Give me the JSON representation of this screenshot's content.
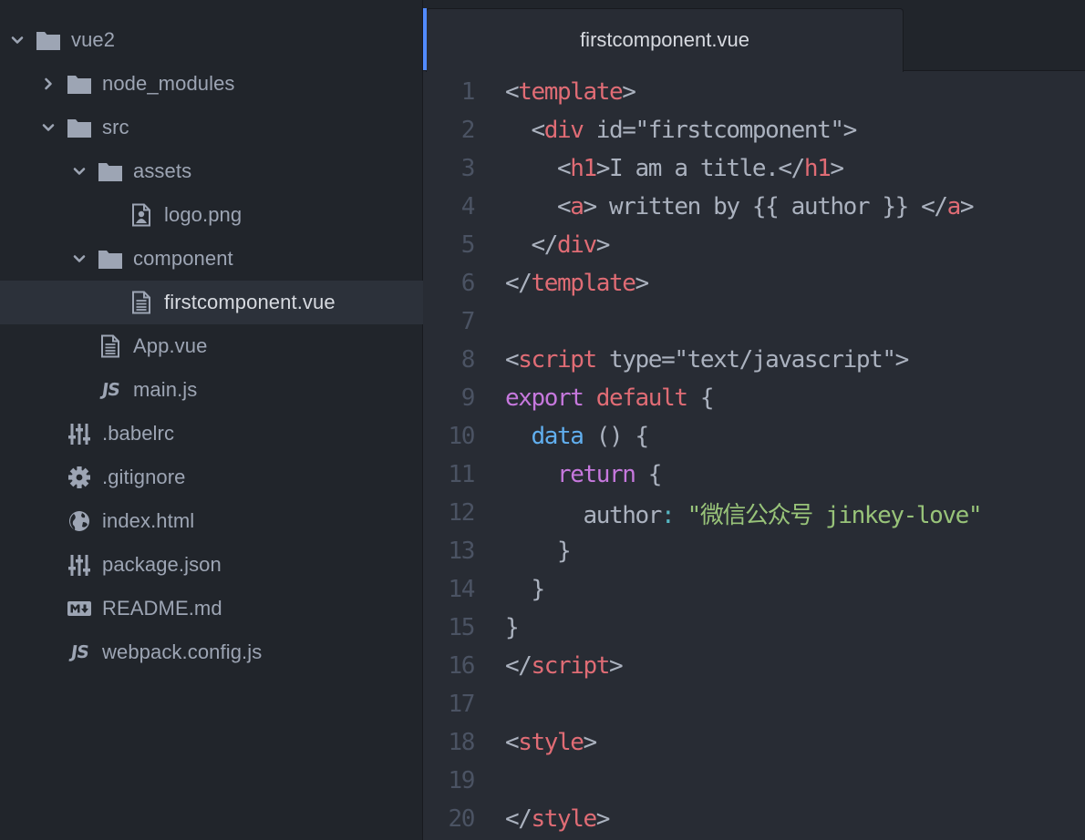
{
  "tree": {
    "rows": [
      {
        "label": "vue2",
        "depth": 0,
        "kind": "folder",
        "state": "expanded",
        "icon": "folder-icon"
      },
      {
        "label": "node_modules",
        "depth": 1,
        "kind": "folder",
        "state": "collapsed",
        "icon": "folder-icon"
      },
      {
        "label": "src",
        "depth": 1,
        "kind": "folder",
        "state": "expanded",
        "icon": "folder-icon"
      },
      {
        "label": "assets",
        "depth": 2,
        "kind": "folder",
        "state": "expanded",
        "icon": "folder-icon"
      },
      {
        "label": "logo.png",
        "depth": 3,
        "kind": "file",
        "icon": "image-file-icon"
      },
      {
        "label": "component",
        "depth": 2,
        "kind": "folder",
        "state": "expanded",
        "icon": "folder-icon"
      },
      {
        "label": "firstcomponent.vue",
        "depth": 3,
        "kind": "file",
        "icon": "text-file-icon",
        "selected": true
      },
      {
        "label": "App.vue",
        "depth": 2,
        "kind": "file",
        "icon": "text-file-icon"
      },
      {
        "label": "main.js",
        "depth": 2,
        "kind": "file",
        "icon": "js-file-icon"
      },
      {
        "label": ".babelrc",
        "depth": 1,
        "kind": "file",
        "icon": "config-file-icon"
      },
      {
        "label": ".gitignore",
        "depth": 1,
        "kind": "file",
        "icon": "gear-icon"
      },
      {
        "label": "index.html",
        "depth": 1,
        "kind": "file",
        "icon": "globe-icon"
      },
      {
        "label": "package.json",
        "depth": 1,
        "kind": "file",
        "icon": "config-file-icon"
      },
      {
        "label": "README.md",
        "depth": 1,
        "kind": "file",
        "icon": "markdown-icon"
      },
      {
        "label": "webpack.config.js",
        "depth": 1,
        "kind": "file",
        "icon": "js-file-icon"
      }
    ],
    "js_glyph": "JS"
  },
  "editor": {
    "tab_title": "firstcomponent.vue",
    "lines": [
      {
        "num": "1",
        "tokens": [
          {
            "t": "<",
            "c": "plain"
          },
          {
            "t": "template",
            "c": "tag"
          },
          {
            "t": ">",
            "c": "plain"
          }
        ]
      },
      {
        "num": "2",
        "tokens": [
          {
            "t": "  <",
            "c": "plain"
          },
          {
            "t": "div",
            "c": "tag"
          },
          {
            "t": " id=\"firstcomponent\">",
            "c": "plain"
          }
        ]
      },
      {
        "num": "3",
        "tokens": [
          {
            "t": "    <",
            "c": "plain"
          },
          {
            "t": "h1",
            "c": "tag"
          },
          {
            "t": ">I am a title.</",
            "c": "plain"
          },
          {
            "t": "h1",
            "c": "tag"
          },
          {
            "t": ">",
            "c": "plain"
          }
        ]
      },
      {
        "num": "4",
        "tokens": [
          {
            "t": "    <",
            "c": "plain"
          },
          {
            "t": "a",
            "c": "tag"
          },
          {
            "t": "> written by {{ author }} </",
            "c": "plain"
          },
          {
            "t": "a",
            "c": "tag"
          },
          {
            "t": ">",
            "c": "plain"
          }
        ]
      },
      {
        "num": "5",
        "tokens": [
          {
            "t": "  </",
            "c": "plain"
          },
          {
            "t": "div",
            "c": "tag"
          },
          {
            "t": ">",
            "c": "plain"
          }
        ]
      },
      {
        "num": "6",
        "tokens": [
          {
            "t": "</",
            "c": "plain"
          },
          {
            "t": "template",
            "c": "tag"
          },
          {
            "t": ">",
            "c": "plain"
          }
        ]
      },
      {
        "num": "7",
        "tokens": []
      },
      {
        "num": "8",
        "tokens": [
          {
            "t": "<",
            "c": "plain"
          },
          {
            "t": "script",
            "c": "tag"
          },
          {
            "t": " type=\"text/javascript\">",
            "c": "plain"
          }
        ]
      },
      {
        "num": "9",
        "tokens": [
          {
            "t": "export",
            "c": "kw"
          },
          {
            "t": " ",
            "c": "plain"
          },
          {
            "t": "default",
            "c": "def"
          },
          {
            "t": " {",
            "c": "plain"
          }
        ]
      },
      {
        "num": "10",
        "tokens": [
          {
            "t": "  ",
            "c": "plain"
          },
          {
            "t": "data",
            "c": "fn"
          },
          {
            "t": " () {",
            "c": "plain"
          }
        ]
      },
      {
        "num": "11",
        "tokens": [
          {
            "t": "    ",
            "c": "plain"
          },
          {
            "t": "return",
            "c": "kw"
          },
          {
            "t": " {",
            "c": "plain"
          }
        ]
      },
      {
        "num": "12",
        "tokens": [
          {
            "t": "      author",
            "c": "plain"
          },
          {
            "t": ":",
            "c": "op"
          },
          {
            "t": " ",
            "c": "plain"
          },
          {
            "t": "\"微信公众号 jinkey-love\"",
            "c": "str"
          }
        ]
      },
      {
        "num": "13",
        "tokens": [
          {
            "t": "    }",
            "c": "plain"
          }
        ]
      },
      {
        "num": "14",
        "tokens": [
          {
            "t": "  }",
            "c": "plain"
          }
        ]
      },
      {
        "num": "15",
        "tokens": [
          {
            "t": "}",
            "c": "plain"
          }
        ]
      },
      {
        "num": "16",
        "tokens": [
          {
            "t": "</",
            "c": "plain"
          },
          {
            "t": "script",
            "c": "tag"
          },
          {
            "t": ">",
            "c": "plain"
          }
        ]
      },
      {
        "num": "17",
        "tokens": []
      },
      {
        "num": "18",
        "tokens": [
          {
            "t": "<",
            "c": "plain"
          },
          {
            "t": "style",
            "c": "tag"
          },
          {
            "t": ">",
            "c": "plain"
          }
        ]
      },
      {
        "num": "19",
        "tokens": []
      },
      {
        "num": "20",
        "tokens": [
          {
            "t": "</",
            "c": "plain"
          },
          {
            "t": "style",
            "c": "tag"
          },
          {
            "t": ">",
            "c": "plain"
          }
        ]
      }
    ]
  },
  "colors": {
    "sidebar_bg": "#21252b",
    "editor_bg": "#282c34",
    "selected_row_bg": "#2c313a",
    "accent": "#528bff",
    "tag": "#e06c75",
    "keyword": "#c678dd",
    "function": "#61afef",
    "string": "#98c379",
    "operator": "#56b6c2"
  }
}
